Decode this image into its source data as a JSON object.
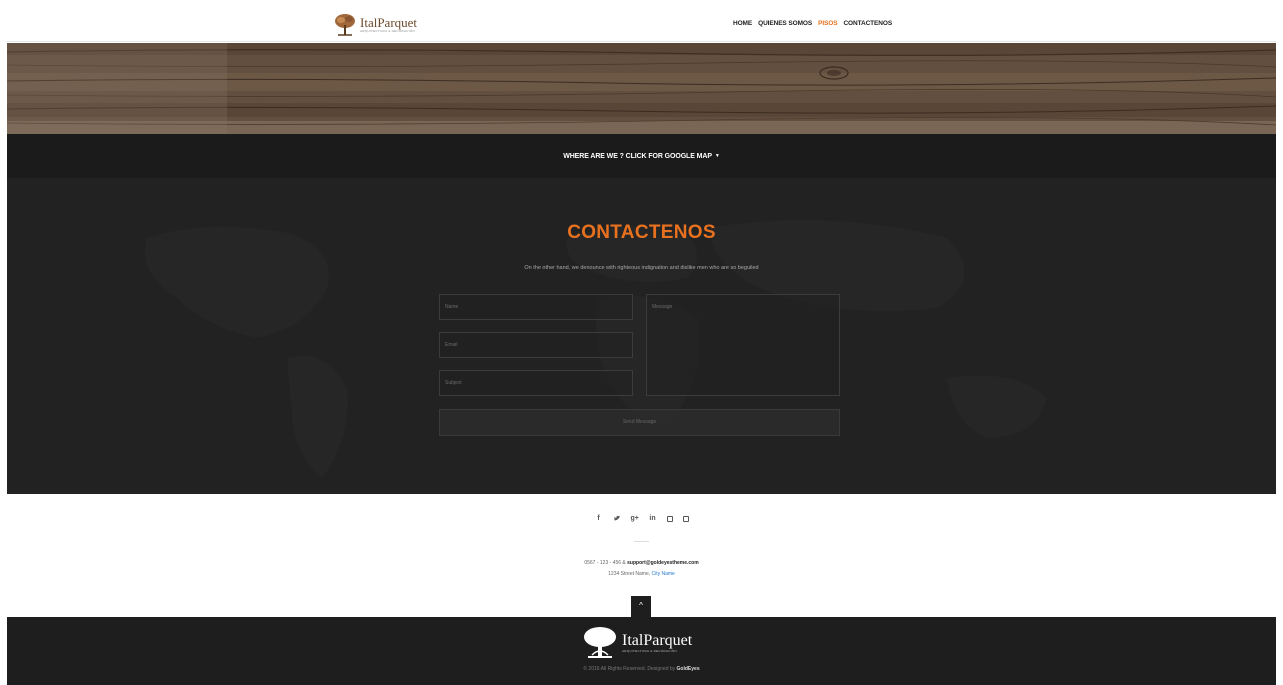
{
  "header": {
    "logo": {
      "name": "ItalParquet",
      "tagline": "ARQUITECTURA & DECORACIÓN"
    },
    "nav": [
      {
        "label": "HOME",
        "active": false
      },
      {
        "label": "QUIENES SOMOS",
        "active": false
      },
      {
        "label": "PISOS",
        "active": true
      },
      {
        "label": "CONTACTENOS",
        "active": false
      }
    ]
  },
  "map_bar": {
    "label": "WHERE ARE WE ? CLICK FOR GOOGLE MAP",
    "caret": "▼"
  },
  "contact": {
    "title": "CONTACTENOS",
    "description": "On the other hand, we denounce with righteous indignation and dislike men who are so beguiled",
    "form": {
      "name_placeholder": "Name",
      "email_placeholder": "Email",
      "subject_placeholder": "Subject",
      "message_placeholder": "Message",
      "send_label": "Send Message"
    }
  },
  "footer": {
    "social": [
      {
        "icon": "facebook-icon",
        "glyph": "f"
      },
      {
        "icon": "twitter-icon",
        "glyph": "t"
      },
      {
        "icon": "google-plus-icon",
        "glyph": "g+"
      },
      {
        "icon": "linkedin-icon",
        "glyph": "in"
      },
      {
        "icon": "instagram-icon",
        "glyph": ""
      },
      {
        "icon": "github-icon",
        "glyph": ""
      }
    ],
    "phone": "0567 - 123 - 456 &",
    "email": "support@goldeyestheme.com",
    "address": "1234 Street Name,",
    "city": "City Name",
    "back_to_top": "^",
    "logo": {
      "name": "ItalParquet",
      "tagline": "ARQUITECTURA & DECORACIÓN"
    },
    "copyright_prefix": "© 2016 All Rights Reserved. Designed by",
    "copyright_brand": "GoldEyes"
  },
  "colors": {
    "accent": "#e8711f",
    "dark": "#1e1e1e",
    "link": "#2a7ac6"
  }
}
